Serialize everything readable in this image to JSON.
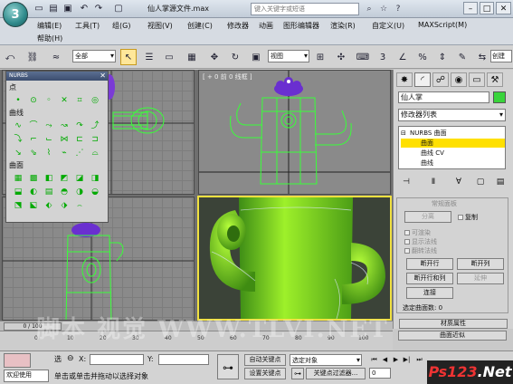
{
  "title_bar": {
    "title": "仙人掌源文件.max",
    "search_placeholder": "键入关键字或短语",
    "quick_access_icons": [
      "new-file-icon",
      "open-folder-icon",
      "save-icon",
      "undo-icon",
      "redo-icon",
      "project-icon"
    ],
    "right_icons": [
      "binoculars-icon",
      "star-icon",
      "help-icon"
    ],
    "window_buttons": [
      "minimize-icon",
      "maximize-icon",
      "close-icon"
    ]
  },
  "menu": {
    "items": [
      "编辑(E)",
      "工具(T)",
      "组(G)",
      "视图(V)",
      "创建(C)",
      "修改器",
      "动画",
      "图形编辑器",
      "渲染(R)",
      "自定义(U)",
      "MAXScript(M)"
    ],
    "help": "帮助(H)"
  },
  "toolbar": {
    "selection_filter": "全部",
    "view_dropdown": "视图",
    "right_label": "创建"
  },
  "nurbs_panel": {
    "title": "NURBS",
    "sections": [
      "点",
      "曲线",
      "曲面"
    ]
  },
  "viewports": {
    "top_right_label": "[ + 0 前 0 线框 ]"
  },
  "command_panel": {
    "object_name": "仙人掌",
    "object_color": "#39d43b",
    "modifier_list": "修改器列表",
    "stack": {
      "root": "NURBS 曲面",
      "children": [
        "曲面",
        "曲线 CV",
        "曲线"
      ],
      "selected": "曲面"
    },
    "rollout": {
      "title": "常规面板",
      "separate_button": "分离",
      "copy_checkbox": "复制",
      "renderable": "可渲染",
      "display_normals": "显示法线",
      "flip_normals": "翻转法线",
      "break_row": "断开行",
      "break_col": "断开列",
      "break_both": "断开行和列",
      "extend": "延伸",
      "join": "连接",
      "selected_surfaces": "选定曲面数: 0"
    },
    "bottom_rollouts": [
      "材质属性",
      "曲面近似"
    ]
  },
  "timeline": {
    "frame": "0 / 100",
    "ticks": [
      "0",
      "10",
      "20",
      "30",
      "40",
      "50",
      "60",
      "70",
      "80",
      "90",
      "100"
    ]
  },
  "status": {
    "welcome": "欢迎使用",
    "select_label": "选",
    "x_label": "X:",
    "y_label": "Y:",
    "auto_key": "自动关键点",
    "set_key": "设置关键点",
    "selected_object": "选定对象",
    "key_filters": "关键点过滤器...",
    "prompt": "单击或单击并拖动以选择对象",
    "frame_field": "0"
  },
  "watermark": "脚本 视觉  WWW.TLVI.NET",
  "badge": {
    "brand": "Ps",
    "number": "123",
    "suffix": ".Net"
  }
}
